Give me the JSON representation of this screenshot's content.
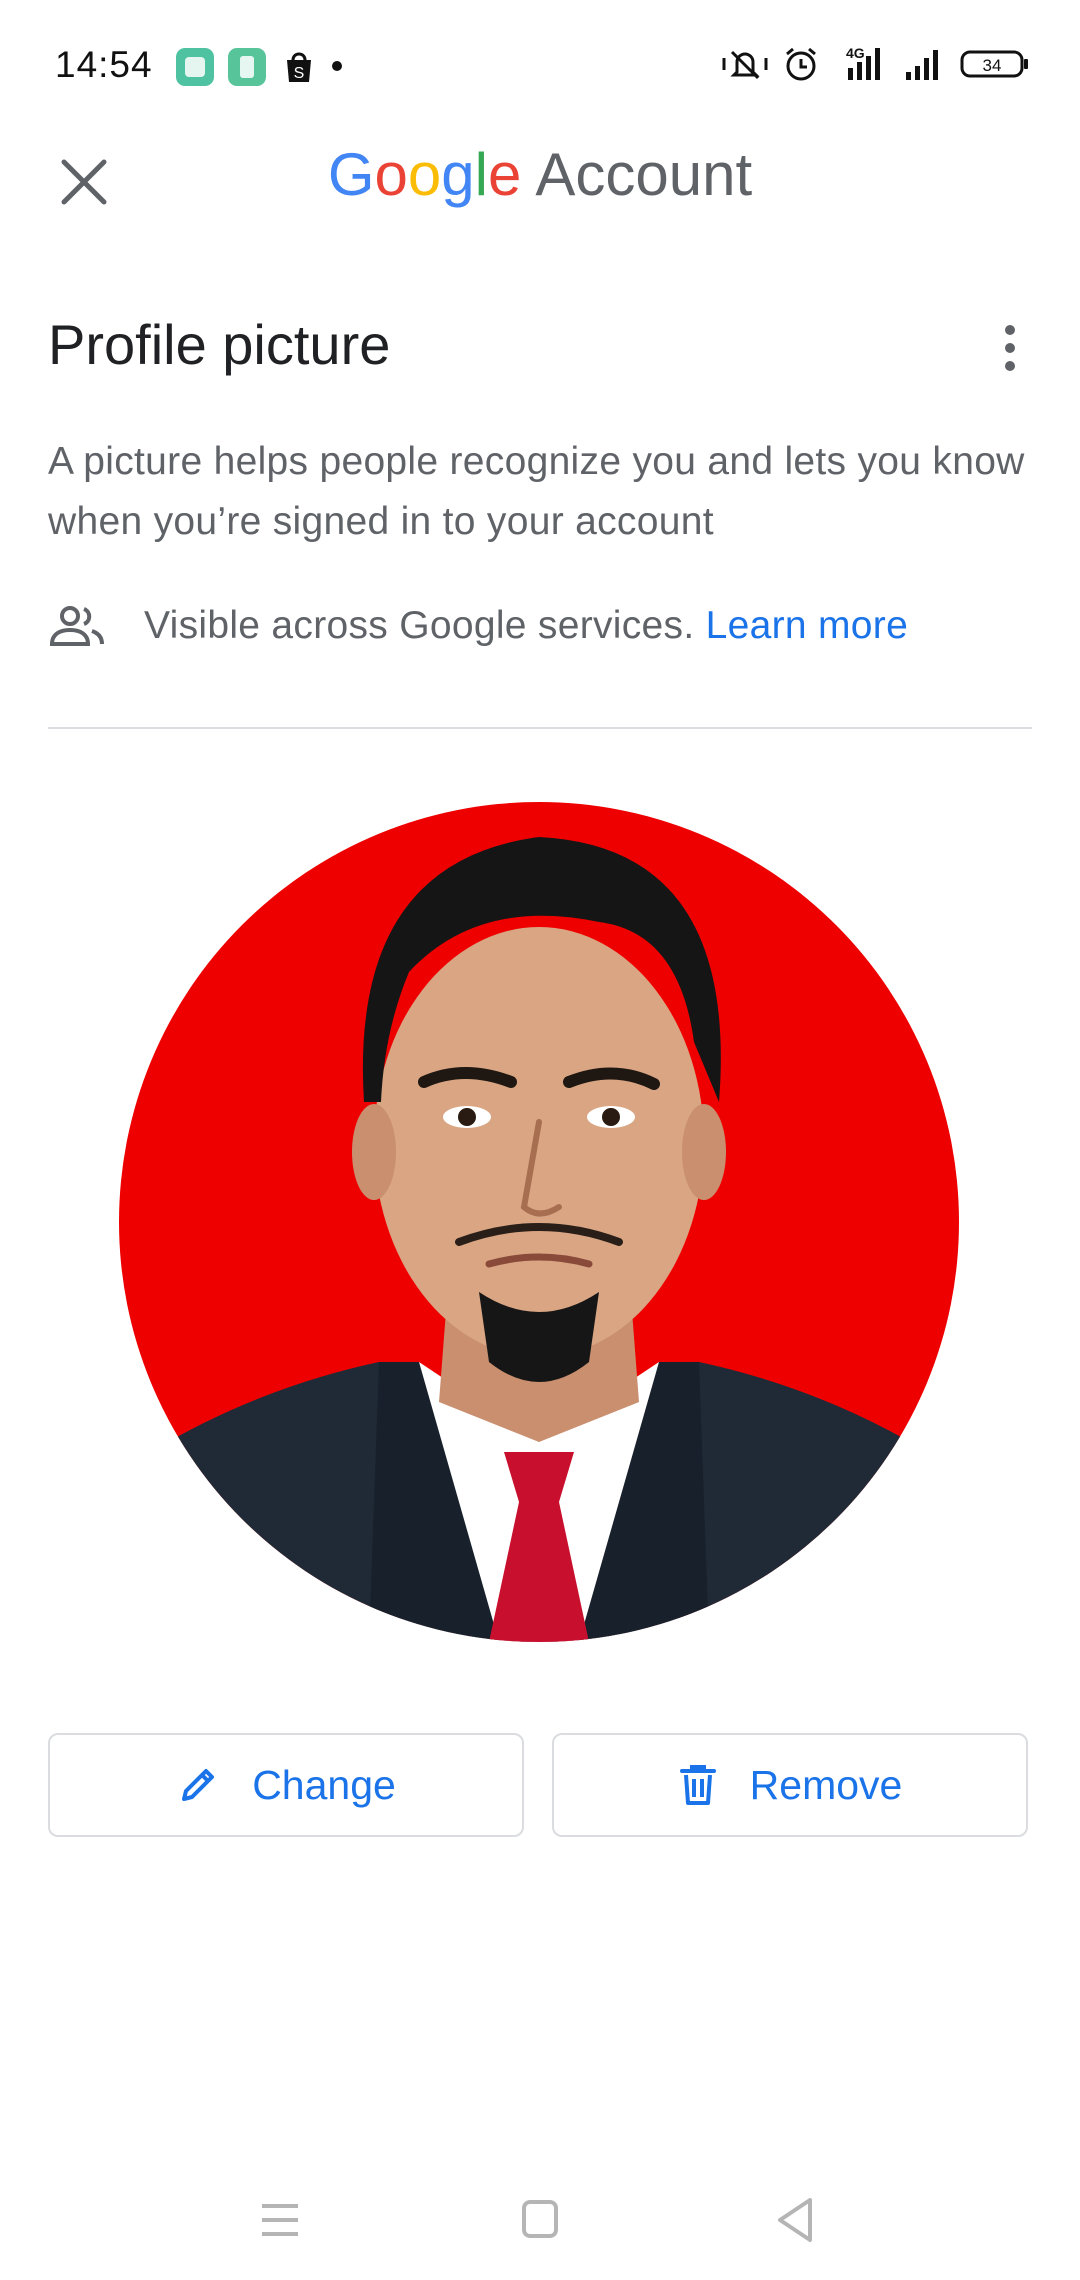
{
  "status_bar": {
    "time": "14:54",
    "network": "4G",
    "battery": "34",
    "icons": [
      "app-icon-1",
      "app-icon-2",
      "shopping-bag-icon",
      "notification-dot",
      "mute-icon",
      "alarm-icon",
      "signal-4g-icon",
      "signal-icon",
      "battery-icon"
    ]
  },
  "app_bar": {
    "brand_letters": [
      "G",
      "o",
      "o",
      "g",
      "l",
      "e"
    ],
    "brand_suffix": "Account",
    "close_icon": "close-icon"
  },
  "header": {
    "title": "Profile picture",
    "menu_icon": "more-vert-icon",
    "description": "A picture helps people recognize you and lets you know when you’re signed in to your account",
    "visibility_text": "Visible across Google services.",
    "learn_more": "Learn more"
  },
  "actions": {
    "change_label": "Change",
    "remove_label": "Remove"
  },
  "colors": {
    "accent": "#1a73e8",
    "google_blue": "#4285F4",
    "google_red": "#EA4335",
    "google_yellow": "#FBBC05",
    "google_green": "#34A853",
    "text_secondary": "#5f6368",
    "avatar_background": "#ee0000"
  }
}
